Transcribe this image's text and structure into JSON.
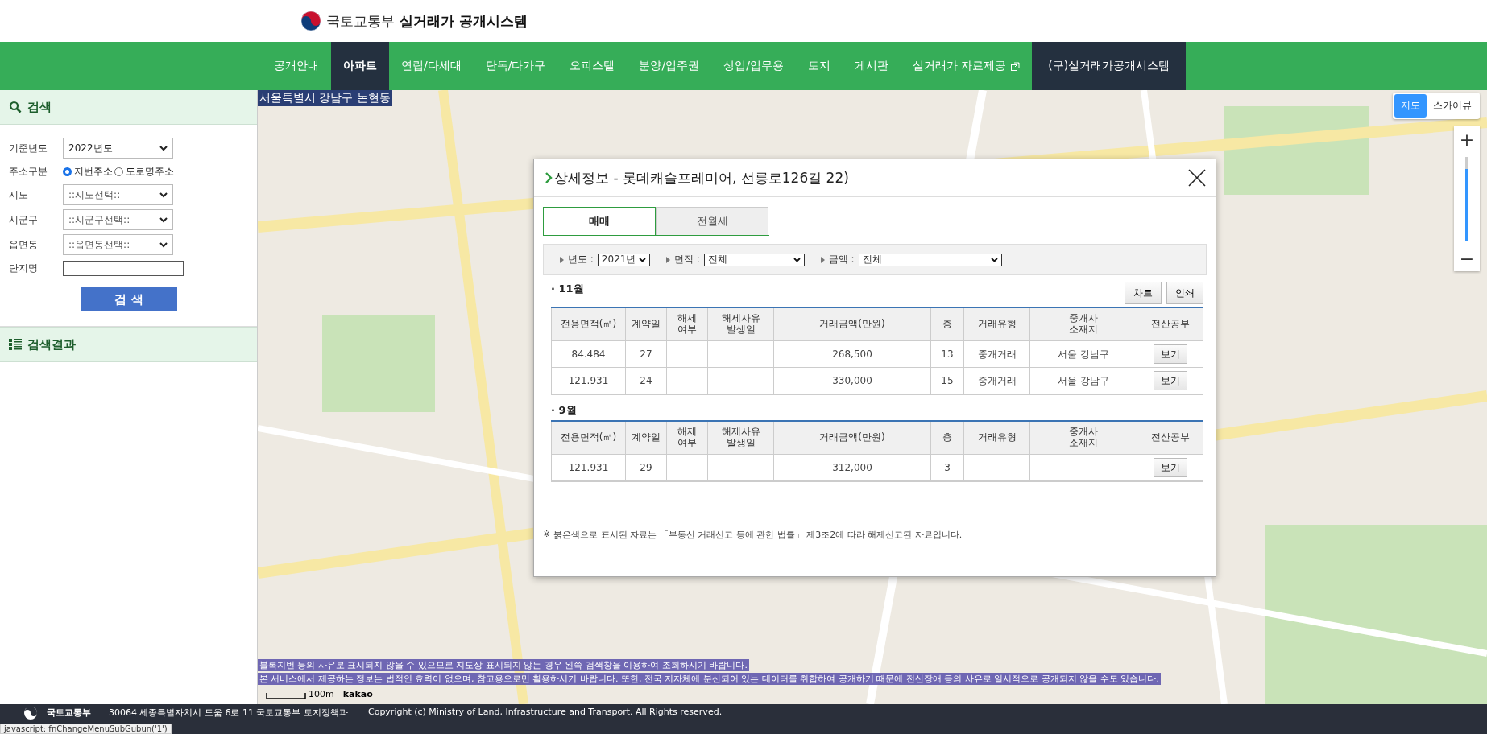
{
  "header": {
    "ministry": "국토교통부",
    "title": "실거래가 공개시스템"
  },
  "nav": [
    {
      "label": "공개안내",
      "selected": false,
      "kind": "normal"
    },
    {
      "label": "아파트",
      "selected": true,
      "kind": "normal"
    },
    {
      "label": "연립/다세대",
      "selected": false,
      "kind": "normal"
    },
    {
      "label": "단독/다가구",
      "selected": false,
      "kind": "normal"
    },
    {
      "label": "오피스텔",
      "selected": false,
      "kind": "normal"
    },
    {
      "label": "분양/입주권",
      "selected": false,
      "kind": "normal"
    },
    {
      "label": "상업/업무용",
      "selected": false,
      "kind": "normal"
    },
    {
      "label": "토지",
      "selected": false,
      "kind": "normal"
    },
    {
      "label": "게시판",
      "selected": false,
      "kind": "normal"
    },
    {
      "label": "실거래가 자료제공",
      "selected": false,
      "kind": "external"
    },
    {
      "label": "(구)실거래가공개시스템",
      "selected": false,
      "kind": "dark"
    }
  ],
  "search": {
    "title": "검색",
    "fields": [
      {
        "label": "기준년도",
        "kind": "select",
        "value": "2022년도"
      },
      {
        "label": "주소구분",
        "kind": "radio",
        "options": [
          {
            "label": "지번주소",
            "selected": true
          },
          {
            "label": "도로명주소",
            "selected": false
          }
        ]
      },
      {
        "label": "시도",
        "kind": "select",
        "value": "::시도선택::"
      },
      {
        "label": "시군구",
        "kind": "select",
        "value": "::시군구선택::"
      },
      {
        "label": "읍면동",
        "kind": "select",
        "value": "::읍면동선택::"
      },
      {
        "label": "단지명",
        "kind": "text"
      }
    ],
    "button": "검 색"
  },
  "results": {
    "title": "검색결과"
  },
  "map": {
    "location": "서울특별시 강남구 논현동",
    "map_type": [
      {
        "label": "지도",
        "selected": true
      },
      {
        "label": "스카이뷰",
        "selected": false
      }
    ],
    "zoom": {
      "plus": "+",
      "minus": "−",
      "level": 0.86
    },
    "notices": [
      "블록지번 등의 사유로 표시되지 않을 수 있으므로 지도상 표시되지 않는 경우 왼쪽 검색창을 이용하여 조회하시기 바랍니다.",
      "본 서비스에서 제공하는 정보는 법적인 효력이 없으며, 참고용으로만 활용하시기 바랍니다. 또한, 전국 지자체에 분산되어 있는 데이터를 취합하여 공개하기 때문에 전산장애 등의 사유로 일시적으로 공개되지 않을 수도 있습니다."
    ],
    "scale": "100m",
    "provider": "kakao"
  },
  "detail": {
    "title": "상세정보 - 롯데캐슬프레미어, 선릉로126길 22)",
    "tabs": [
      {
        "label": "매매",
        "selected": true
      },
      {
        "label": "전월세",
        "selected": false
      }
    ],
    "filters": [
      {
        "label": "년도 :",
        "value": "2021년"
      },
      {
        "label": "면적 :",
        "value": "전체"
      },
      {
        "label": "금액 :",
        "value": "전체"
      }
    ],
    "actions": [
      "차트",
      "인쇄"
    ],
    "months": [
      {
        "month": "· 11월",
        "columns": [
          "전용면적(㎡)",
          "계약일",
          "해제\n여부",
          "해제사유\n발생일",
          "거래금액(만원)",
          "층",
          "거래유형",
          "중개사\n소재지",
          "전산공부"
        ],
        "rows": [
          {
            "cells": [
              "84.484",
              "27",
              "",
              "",
              "268,500",
              "13",
              "중개거래",
              "서울 강남구"
            ],
            "button": "보기"
          },
          {
            "cells": [
              "121.931",
              "24",
              "",
              "",
              "330,000",
              "15",
              "중개거래",
              "서울 강남구"
            ],
            "button": "보기"
          }
        ]
      },
      {
        "month": "· 9월",
        "columns": [
          "전용면적(㎡)",
          "계약일",
          "해제\n여부",
          "해제사유\n발생일",
          "거래금액(만원)",
          "층",
          "거래유형",
          "중개사\n소재지",
          "전산공부"
        ],
        "rows": [
          {
            "cells": [
              "121.931",
              "29",
              "",
              "",
              "312,000",
              "3",
              "-",
              "-"
            ],
            "button": "보기"
          }
        ]
      }
    ],
    "note_mark": "※",
    "note": "붉은색으로 표시된 자료는 「부동산 거래신고 등에 관한 법률」 제3조2에 따라 해제신고된 자료입니다."
  },
  "footer": {
    "ministry": "국토교통부",
    "address": "30064 세종특별자치시 도움 6로 11 국토교통부 토지정책과",
    "copyright": "Copyright (c) Ministry of Land, Infrastructure and Transport. All Rights reserved."
  },
  "status_url": "javascript: fnChangeMenuSubGubun('1')"
}
